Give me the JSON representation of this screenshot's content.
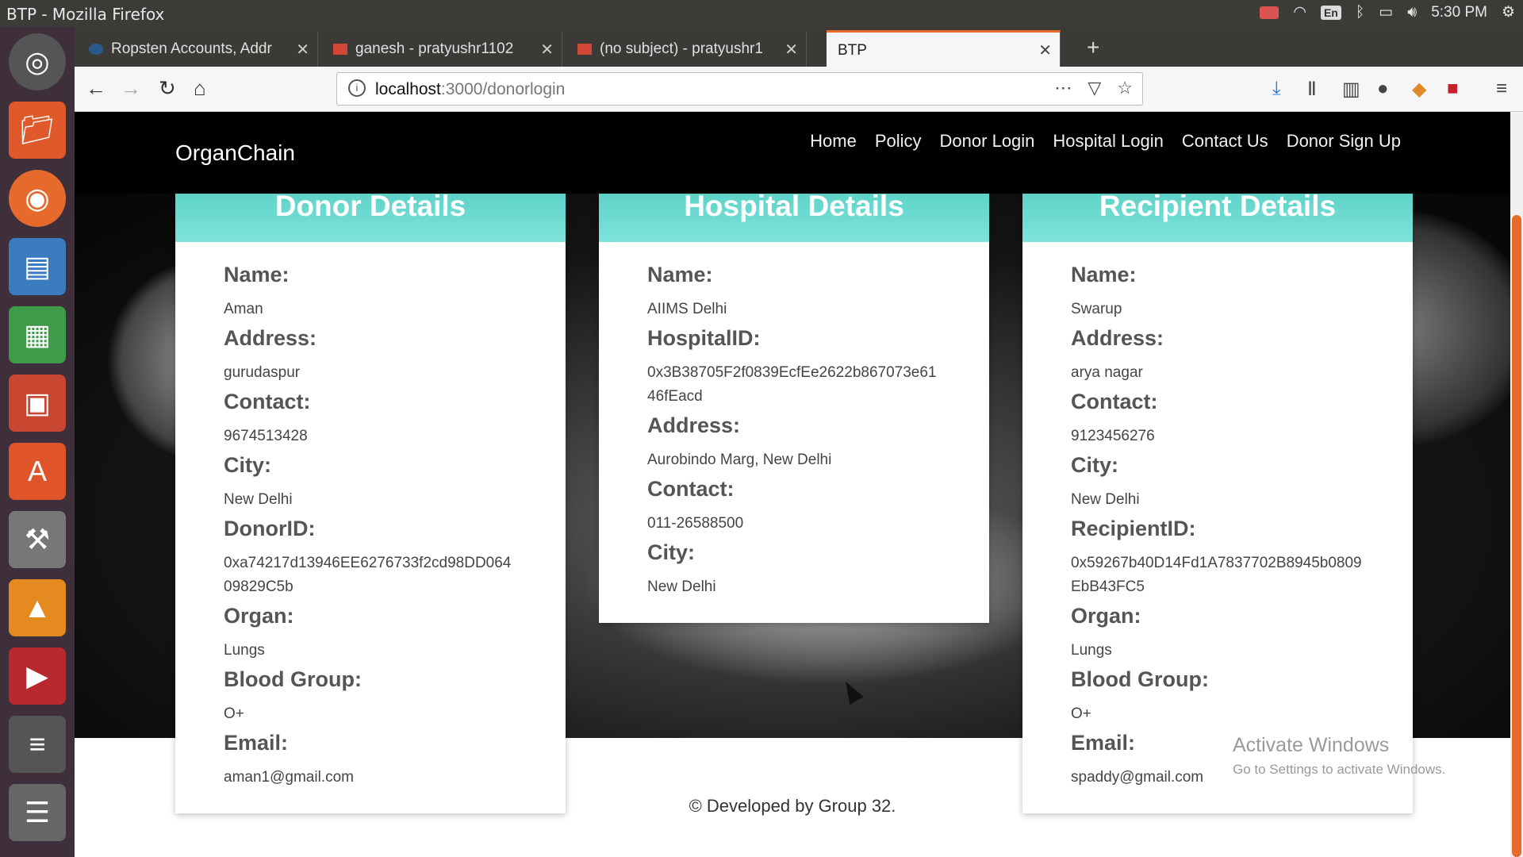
{
  "window": {
    "title": "BTP - Mozilla Firefox"
  },
  "system_tray": {
    "language": "En",
    "time": "5:30 PM"
  },
  "tabs": [
    {
      "label": "Ropsten Accounts, Addr"
    },
    {
      "label": "ganesh - pratyushr1102"
    },
    {
      "label": "(no subject) - pratyushr1"
    },
    {
      "label": "BTP"
    }
  ],
  "address_bar": {
    "host": "localhost",
    "path": ":3000/donorlogin"
  },
  "site": {
    "brand": "OrganChain",
    "nav": [
      "Home",
      "Policy",
      "Donor Login",
      "Hospital Login",
      "Contact Us",
      "Donor Sign Up"
    ],
    "footer": "© Developed by Group 32."
  },
  "donor": {
    "heading": "Donor Details",
    "name_label": "Name:",
    "name": "Aman",
    "address_label": "Address:",
    "address": "gurudaspur",
    "contact_label": "Contact:",
    "contact": "9674513428",
    "city_label": "City:",
    "city": "New Delhi",
    "id_label": "DonorID:",
    "id": "0xa74217d13946EE6276733f2cd98DD06409829C5b",
    "organ_label": "Organ:",
    "organ": "Lungs",
    "blood_label": "Blood Group:",
    "blood": "O+",
    "email_label": "Email:",
    "email": "aman1@gmail.com"
  },
  "hospital": {
    "heading": "Hospital Details",
    "name_label": "Name:",
    "name": "AIIMS Delhi",
    "id_label": "HospitalID:",
    "id": "0x3B38705F2f0839EcfEe2622b867073e6146fEacd",
    "address_label": "Address:",
    "address": "Aurobindo Marg, New Delhi",
    "contact_label": "Contact:",
    "contact": "011-26588500",
    "city_label": "City:",
    "city": "New Delhi"
  },
  "recipient": {
    "heading": "Recipient Details",
    "name_label": "Name:",
    "name": "Swarup",
    "address_label": "Address:",
    "address": "arya nagar",
    "contact_label": "Contact:",
    "contact": "9123456276",
    "city_label": "City:",
    "city": "New Delhi",
    "id_label": "RecipientID:",
    "id": "0x59267b40D14Fd1A7837702B8945b0809EbB43FC5",
    "organ_label": "Organ:",
    "organ": "Lungs",
    "blood_label": "Blood Group:",
    "blood": "O+",
    "email_label": "Email:",
    "email": "spaddy@gmail.com"
  },
  "watermark": {
    "line1": "Activate Windows",
    "line2": "Go to Settings to activate Windows."
  },
  "colors": {
    "card_header": "#6edbd3",
    "accent": "#e66a2c"
  }
}
